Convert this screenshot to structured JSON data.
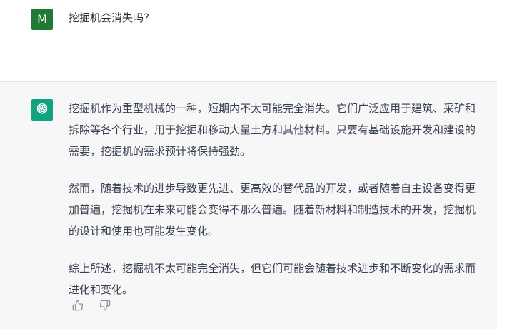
{
  "user": {
    "avatar_letter": "M",
    "message": "挖掘机会消失吗？"
  },
  "assistant": {
    "avatar_icon": "openai-logo-icon",
    "paragraphs": [
      "挖掘机作为重型机械的一种，短期内不太可能完全消失。它们广泛应用于建筑、采矿和拆除等各个行业，用于挖掘和移动大量土方和其他材料。只要有基础设施开发和建设的需要，挖掘机的需求预计将保持强劲。",
      "然而，随着技术的进步导致更先进、更高效的替代品的开发，或者随着自主设备变得更加普遍，挖掘机在未来可能会变得不那么普遍。随着新材料和制造技术的开发，挖掘机的设计和使用也可能发生变化。",
      "综上所述，挖掘机不太可能完全消失，但它们可能会随着技术进步和不断变化的需求而进化和变化。"
    ],
    "feedback": {
      "up_icon": "thumbs-up-icon",
      "down_icon": "thumbs-down-icon"
    }
  },
  "colors": {
    "user_avatar_bg": "#1e7a34",
    "bot_avatar_bg": "#10a37f",
    "assistant_bg": "#f7f7f8",
    "text": "#374151"
  }
}
